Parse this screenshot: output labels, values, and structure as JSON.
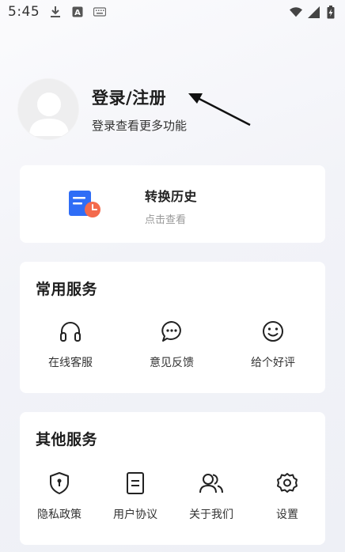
{
  "status_bar": {
    "time": "5:45",
    "icons": [
      "download-icon",
      "keyboard-a-icon",
      "keyboard-icon",
      "wifi-icon",
      "signal-icon",
      "battery-charging-icon"
    ]
  },
  "profile": {
    "title": "登录/注册",
    "subtitle": "登录查看更多功能"
  },
  "history": {
    "title": "转换历史",
    "subtitle": "点击查看",
    "icon": "document-clock-icon"
  },
  "common_services": {
    "title": "常用服务",
    "items": [
      {
        "label": "在线客服",
        "icon": "headphones-icon"
      },
      {
        "label": "意见反馈",
        "icon": "chat-bubble-icon"
      },
      {
        "label": "给个好评",
        "icon": "smiley-icon"
      }
    ]
  },
  "other_services": {
    "title": "其他服务",
    "items": [
      {
        "label": "隐私政策",
        "icon": "shield-lock-icon"
      },
      {
        "label": "用户协议",
        "icon": "document-icon"
      },
      {
        "label": "关于我们",
        "icon": "users-icon"
      },
      {
        "label": "设置",
        "icon": "gear-icon"
      }
    ]
  },
  "colors": {
    "history_icon_blue": "#2f6df6",
    "history_icon_orange": "#f36a4d",
    "text_primary": "#1e1e1e"
  }
}
